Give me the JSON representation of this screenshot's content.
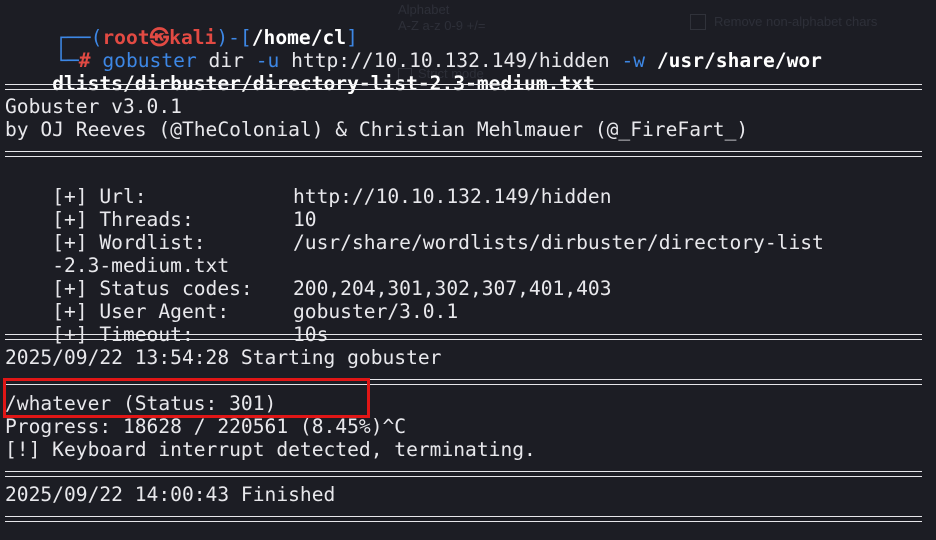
{
  "prompt": {
    "corner_top": "┌──(",
    "user": "root",
    "at_symbol": "㉿",
    "host": "kali",
    "close_bracket": ")-[",
    "path": "/home/cl",
    "end_bracket": "]",
    "corner_bottom": "└─",
    "hash": "#"
  },
  "command": {
    "program": "gobuster",
    "args_1": " dir ",
    "flag_u": "-u",
    "url": " http://10.10.132.149/hidden ",
    "flag_w": "-w",
    "wordlist_part1": " /usr/share/wor",
    "wordlist_part2": "dlists/dirbuster/directory-list-2.3-medium.txt"
  },
  "banner": {
    "version": "Gobuster v3.0.1",
    "authors": "by OJ Reeves (@TheColonial) & Christian Mehlmauer (@_FireFart_)"
  },
  "settings": [
    {
      "label": "[+] Url:",
      "value": "http://10.10.132.149/hidden"
    },
    {
      "label": "[+] Threads:",
      "value": "10"
    },
    {
      "label": "[+] Wordlist:",
      "value": "/usr/share/wordlists/dirbuster/directory-list"
    },
    {
      "label": "",
      "value": "-2.3-medium.txt"
    },
    {
      "label": "[+] Status codes:",
      "value": "200,204,301,302,307,401,403"
    },
    {
      "label": "[+] User Agent:",
      "value": "gobuster/3.0.1"
    },
    {
      "label": "[+] Timeout:",
      "value": "10s"
    }
  ],
  "start_line": "2025/09/22 13:54:28 Starting gobuster",
  "result_line": "/whatever (Status: 301)",
  "progress_line": "Progress: 18628 / 220561 (8.45%)^C",
  "interrupt_line": "[!] Keyboard interrupt detected, terminating.",
  "finish_line": "2025/09/22 14:00:43 Finished",
  "background_ghost": {
    "text_a": "Alphabet",
    "text_b": "A-Z a-z 0-9 +/=",
    "text_c": "Remove non-alphabet chars",
    "text_d": "Strict mode"
  },
  "colors": {
    "background": "#1c1d24",
    "prompt_blue": "#3d87e5",
    "prompt_red": "#e24a43",
    "highlight_red": "#e01616"
  }
}
